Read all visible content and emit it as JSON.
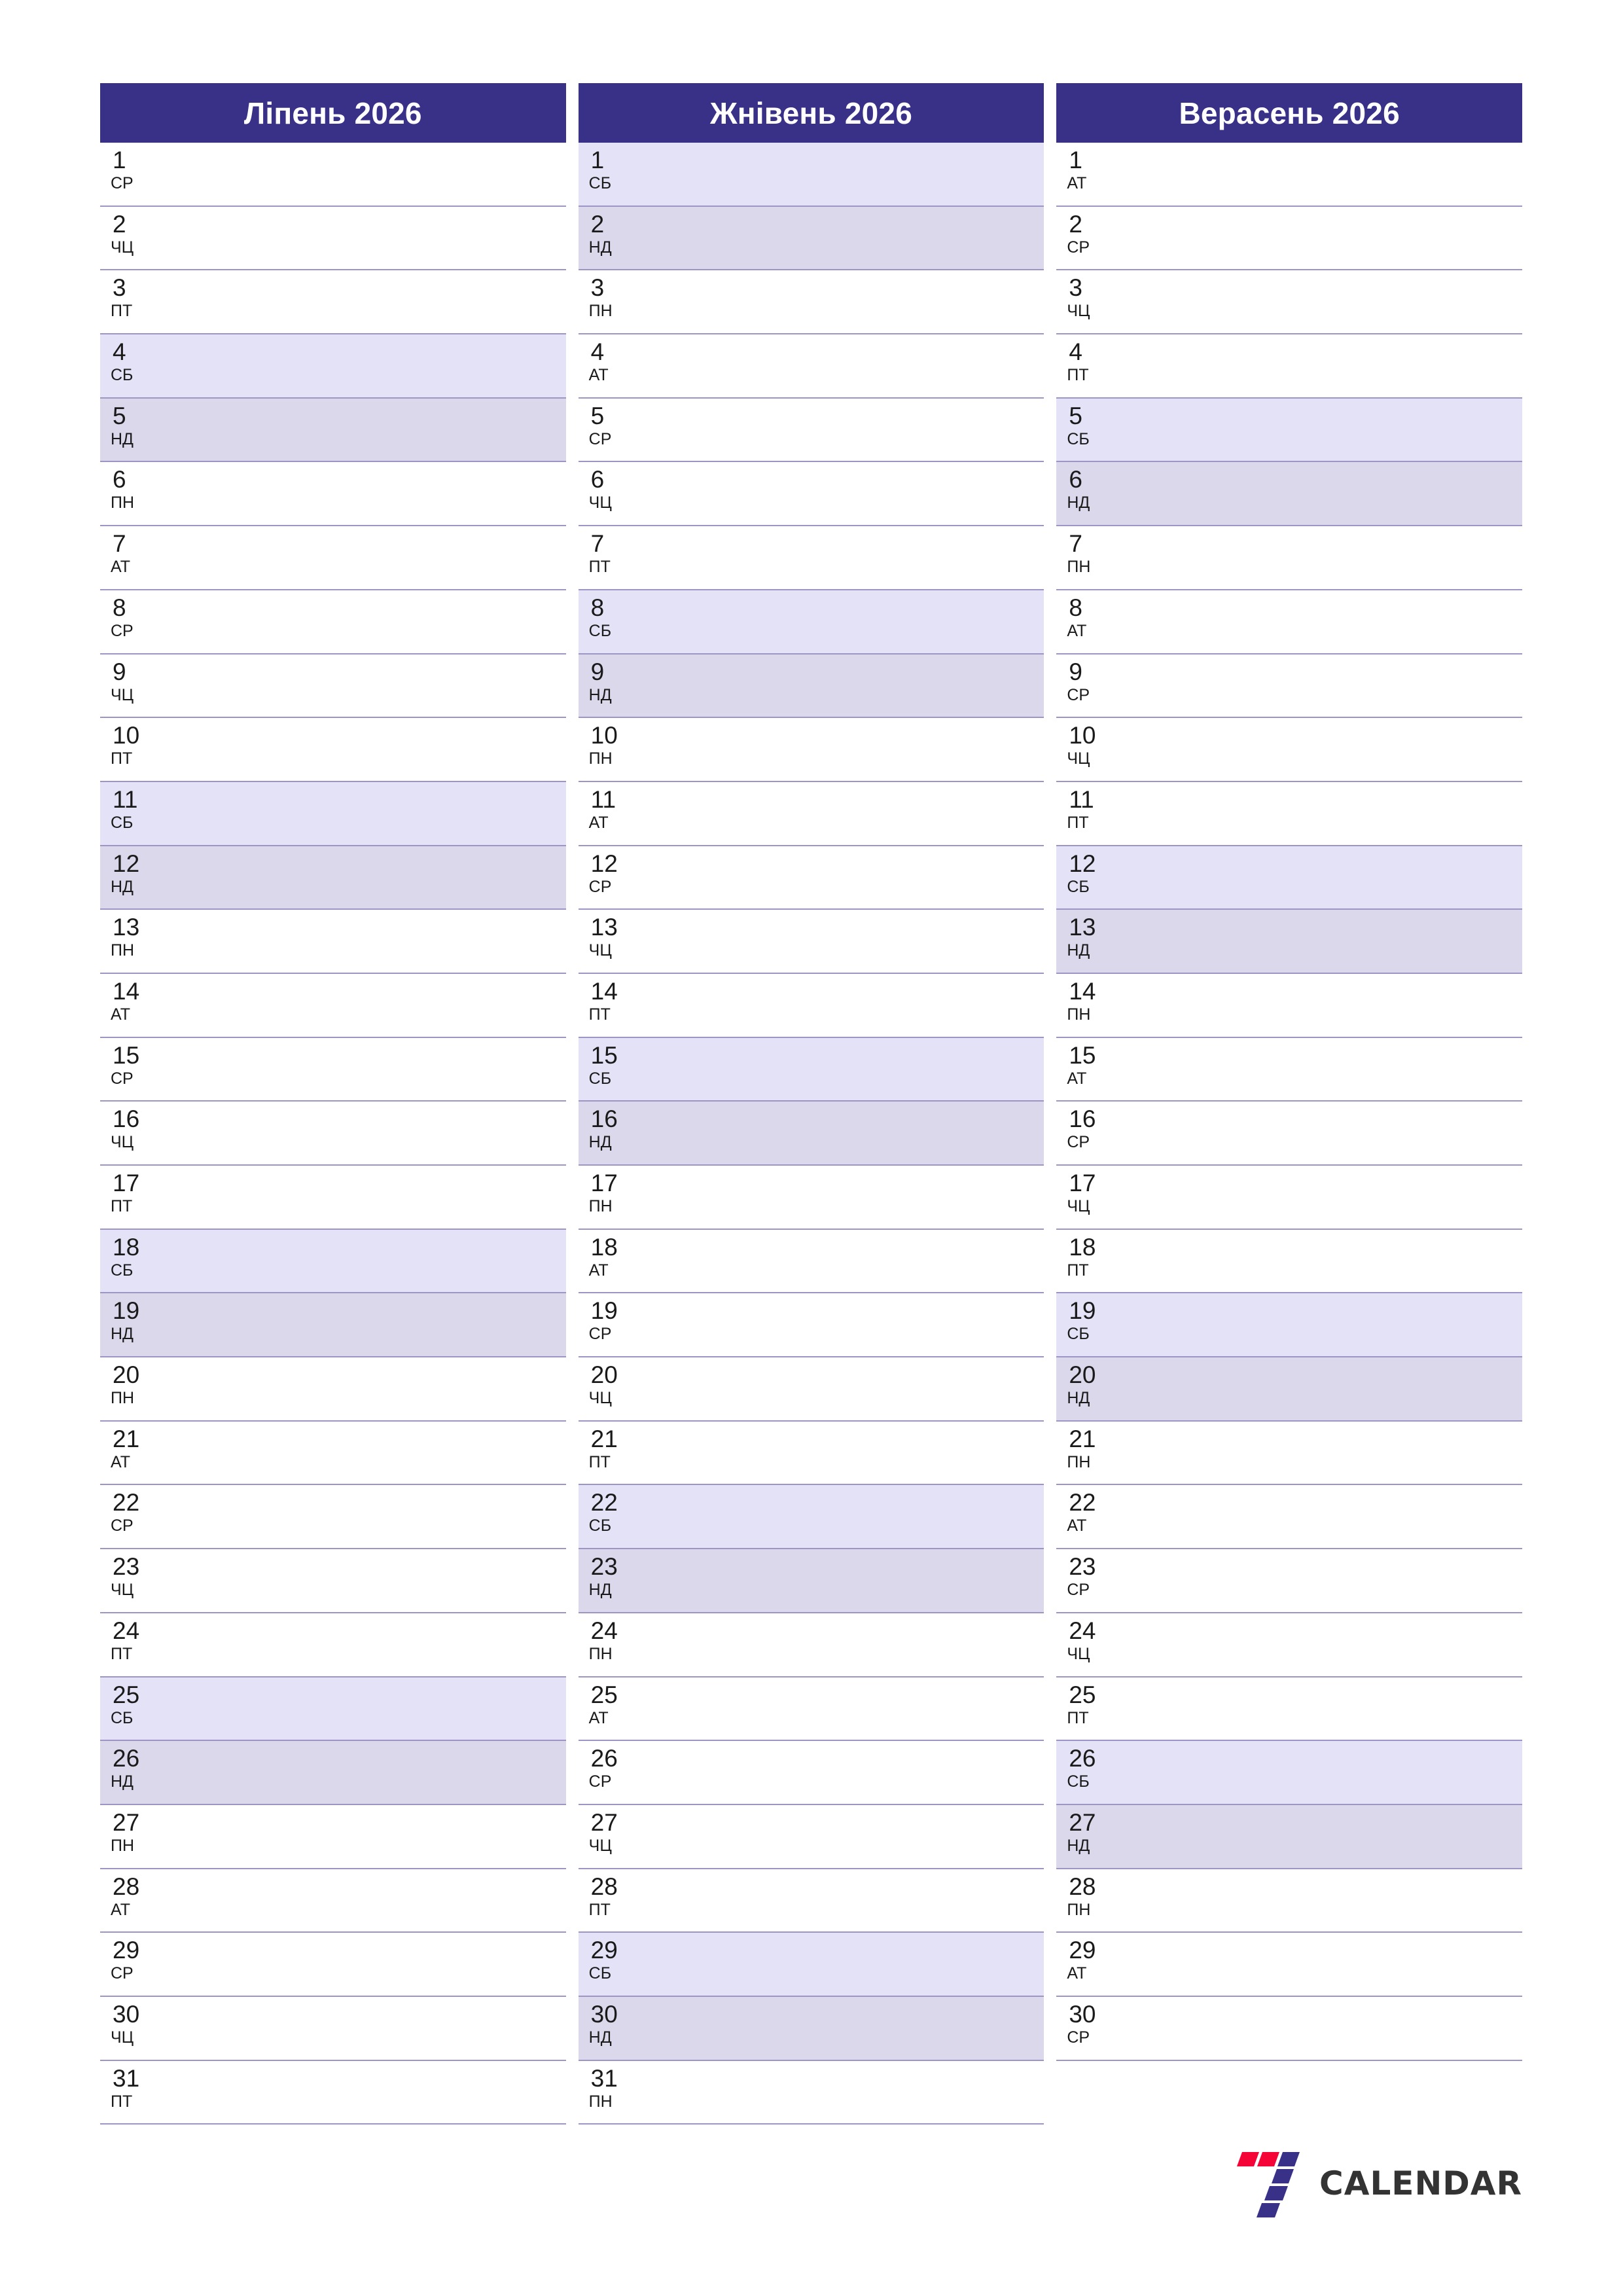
{
  "logo": {
    "text": "CALENDAR",
    "mark_name": "seven-calendar-logo",
    "colors": {
      "red": "#f50537",
      "purple": "#393088"
    }
  },
  "theme": {
    "header_bg": "#393088",
    "header_text": "#ffffff",
    "saturday_bg": "#e3e2f6",
    "sunday_bg": "#dcd8ec",
    "row_divider": "#9d96c4",
    "day_text": "#1a1a1a",
    "page_bg": "#ffffff"
  },
  "weekday_abbr": {
    "mon": "ПН",
    "tue": "АТ",
    "wed": "СР",
    "thu": "ЧЦ",
    "fri": "ПТ",
    "sat": "СБ",
    "sun": "НД"
  },
  "months": [
    {
      "title": "Ліпень 2026",
      "days": [
        {
          "n": "1",
          "wd": "СР",
          "type": "weekday"
        },
        {
          "n": "2",
          "wd": "ЧЦ",
          "type": "weekday"
        },
        {
          "n": "3",
          "wd": "ПТ",
          "type": "weekday"
        },
        {
          "n": "4",
          "wd": "СБ",
          "type": "sat"
        },
        {
          "n": "5",
          "wd": "НД",
          "type": "sun"
        },
        {
          "n": "6",
          "wd": "ПН",
          "type": "weekday"
        },
        {
          "n": "7",
          "wd": "АТ",
          "type": "weekday"
        },
        {
          "n": "8",
          "wd": "СР",
          "type": "weekday"
        },
        {
          "n": "9",
          "wd": "ЧЦ",
          "type": "weekday"
        },
        {
          "n": "10",
          "wd": "ПТ",
          "type": "weekday"
        },
        {
          "n": "11",
          "wd": "СБ",
          "type": "sat"
        },
        {
          "n": "12",
          "wd": "НД",
          "type": "sun"
        },
        {
          "n": "13",
          "wd": "ПН",
          "type": "weekday"
        },
        {
          "n": "14",
          "wd": "АТ",
          "type": "weekday"
        },
        {
          "n": "15",
          "wd": "СР",
          "type": "weekday"
        },
        {
          "n": "16",
          "wd": "ЧЦ",
          "type": "weekday"
        },
        {
          "n": "17",
          "wd": "ПТ",
          "type": "weekday"
        },
        {
          "n": "18",
          "wd": "СБ",
          "type": "sat"
        },
        {
          "n": "19",
          "wd": "НД",
          "type": "sun"
        },
        {
          "n": "20",
          "wd": "ПН",
          "type": "weekday"
        },
        {
          "n": "21",
          "wd": "АТ",
          "type": "weekday"
        },
        {
          "n": "22",
          "wd": "СР",
          "type": "weekday"
        },
        {
          "n": "23",
          "wd": "ЧЦ",
          "type": "weekday"
        },
        {
          "n": "24",
          "wd": "ПТ",
          "type": "weekday"
        },
        {
          "n": "25",
          "wd": "СБ",
          "type": "sat"
        },
        {
          "n": "26",
          "wd": "НД",
          "type": "sun"
        },
        {
          "n": "27",
          "wd": "ПН",
          "type": "weekday"
        },
        {
          "n": "28",
          "wd": "АТ",
          "type": "weekday"
        },
        {
          "n": "29",
          "wd": "СР",
          "type": "weekday"
        },
        {
          "n": "30",
          "wd": "ЧЦ",
          "type": "weekday"
        },
        {
          "n": "31",
          "wd": "ПТ",
          "type": "weekday"
        }
      ]
    },
    {
      "title": "Жнівень 2026",
      "days": [
        {
          "n": "1",
          "wd": "СБ",
          "type": "sat"
        },
        {
          "n": "2",
          "wd": "НД",
          "type": "sun"
        },
        {
          "n": "3",
          "wd": "ПН",
          "type": "weekday"
        },
        {
          "n": "4",
          "wd": "АТ",
          "type": "weekday"
        },
        {
          "n": "5",
          "wd": "СР",
          "type": "weekday"
        },
        {
          "n": "6",
          "wd": "ЧЦ",
          "type": "weekday"
        },
        {
          "n": "7",
          "wd": "ПТ",
          "type": "weekday"
        },
        {
          "n": "8",
          "wd": "СБ",
          "type": "sat"
        },
        {
          "n": "9",
          "wd": "НД",
          "type": "sun"
        },
        {
          "n": "10",
          "wd": "ПН",
          "type": "weekday"
        },
        {
          "n": "11",
          "wd": "АТ",
          "type": "weekday"
        },
        {
          "n": "12",
          "wd": "СР",
          "type": "weekday"
        },
        {
          "n": "13",
          "wd": "ЧЦ",
          "type": "weekday"
        },
        {
          "n": "14",
          "wd": "ПТ",
          "type": "weekday"
        },
        {
          "n": "15",
          "wd": "СБ",
          "type": "sat"
        },
        {
          "n": "16",
          "wd": "НД",
          "type": "sun"
        },
        {
          "n": "17",
          "wd": "ПН",
          "type": "weekday"
        },
        {
          "n": "18",
          "wd": "АТ",
          "type": "weekday"
        },
        {
          "n": "19",
          "wd": "СР",
          "type": "weekday"
        },
        {
          "n": "20",
          "wd": "ЧЦ",
          "type": "weekday"
        },
        {
          "n": "21",
          "wd": "ПТ",
          "type": "weekday"
        },
        {
          "n": "22",
          "wd": "СБ",
          "type": "sat"
        },
        {
          "n": "23",
          "wd": "НД",
          "type": "sun"
        },
        {
          "n": "24",
          "wd": "ПН",
          "type": "weekday"
        },
        {
          "n": "25",
          "wd": "АТ",
          "type": "weekday"
        },
        {
          "n": "26",
          "wd": "СР",
          "type": "weekday"
        },
        {
          "n": "27",
          "wd": "ЧЦ",
          "type": "weekday"
        },
        {
          "n": "28",
          "wd": "ПТ",
          "type": "weekday"
        },
        {
          "n": "29",
          "wd": "СБ",
          "type": "sat"
        },
        {
          "n": "30",
          "wd": "НД",
          "type": "sun"
        },
        {
          "n": "31",
          "wd": "ПН",
          "type": "weekday"
        }
      ]
    },
    {
      "title": "Верасень 2026",
      "days": [
        {
          "n": "1",
          "wd": "АТ",
          "type": "weekday"
        },
        {
          "n": "2",
          "wd": "СР",
          "type": "weekday"
        },
        {
          "n": "3",
          "wd": "ЧЦ",
          "type": "weekday"
        },
        {
          "n": "4",
          "wd": "ПТ",
          "type": "weekday"
        },
        {
          "n": "5",
          "wd": "СБ",
          "type": "sat"
        },
        {
          "n": "6",
          "wd": "НД",
          "type": "sun"
        },
        {
          "n": "7",
          "wd": "ПН",
          "type": "weekday"
        },
        {
          "n": "8",
          "wd": "АТ",
          "type": "weekday"
        },
        {
          "n": "9",
          "wd": "СР",
          "type": "weekday"
        },
        {
          "n": "10",
          "wd": "ЧЦ",
          "type": "weekday"
        },
        {
          "n": "11",
          "wd": "ПТ",
          "type": "weekday"
        },
        {
          "n": "12",
          "wd": "СБ",
          "type": "sat"
        },
        {
          "n": "13",
          "wd": "НД",
          "type": "sun"
        },
        {
          "n": "14",
          "wd": "ПН",
          "type": "weekday"
        },
        {
          "n": "15",
          "wd": "АТ",
          "type": "weekday"
        },
        {
          "n": "16",
          "wd": "СР",
          "type": "weekday"
        },
        {
          "n": "17",
          "wd": "ЧЦ",
          "type": "weekday"
        },
        {
          "n": "18",
          "wd": "ПТ",
          "type": "weekday"
        },
        {
          "n": "19",
          "wd": "СБ",
          "type": "sat"
        },
        {
          "n": "20",
          "wd": "НД",
          "type": "sun"
        },
        {
          "n": "21",
          "wd": "ПН",
          "type": "weekday"
        },
        {
          "n": "22",
          "wd": "АТ",
          "type": "weekday"
        },
        {
          "n": "23",
          "wd": "СР",
          "type": "weekday"
        },
        {
          "n": "24",
          "wd": "ЧЦ",
          "type": "weekday"
        },
        {
          "n": "25",
          "wd": "ПТ",
          "type": "weekday"
        },
        {
          "n": "26",
          "wd": "СБ",
          "type": "sat"
        },
        {
          "n": "27",
          "wd": "НД",
          "type": "sun"
        },
        {
          "n": "28",
          "wd": "ПН",
          "type": "weekday"
        },
        {
          "n": "29",
          "wd": "АТ",
          "type": "weekday"
        },
        {
          "n": "30",
          "wd": "СР",
          "type": "weekday"
        }
      ]
    }
  ]
}
